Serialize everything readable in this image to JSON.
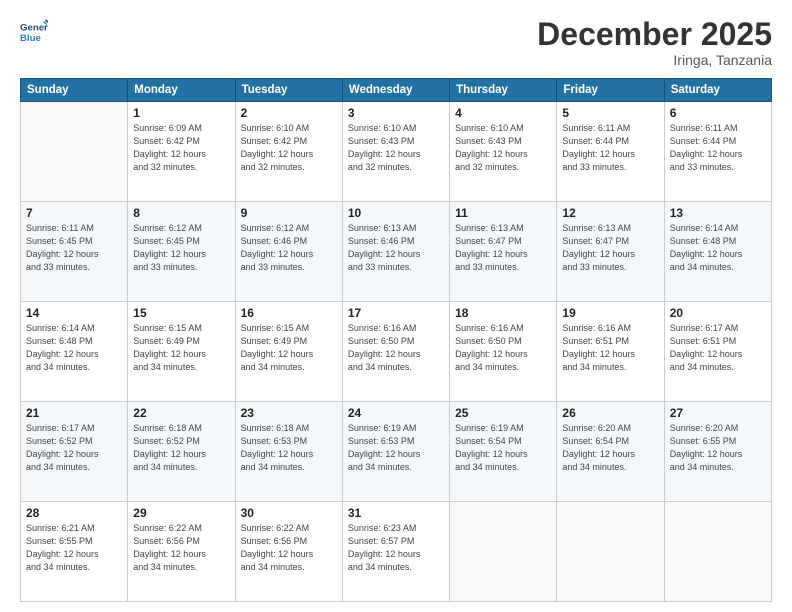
{
  "header": {
    "logo_line1": "General",
    "logo_line2": "Blue",
    "month": "December 2025",
    "location": "Iringa, Tanzania"
  },
  "days_of_week": [
    "Sunday",
    "Monday",
    "Tuesday",
    "Wednesday",
    "Thursday",
    "Friday",
    "Saturday"
  ],
  "weeks": [
    [
      {
        "day": "",
        "info": ""
      },
      {
        "day": "1",
        "info": "Sunrise: 6:09 AM\nSunset: 6:42 PM\nDaylight: 12 hours\nand 32 minutes."
      },
      {
        "day": "2",
        "info": "Sunrise: 6:10 AM\nSunset: 6:42 PM\nDaylight: 12 hours\nand 32 minutes."
      },
      {
        "day": "3",
        "info": "Sunrise: 6:10 AM\nSunset: 6:43 PM\nDaylight: 12 hours\nand 32 minutes."
      },
      {
        "day": "4",
        "info": "Sunrise: 6:10 AM\nSunset: 6:43 PM\nDaylight: 12 hours\nand 32 minutes."
      },
      {
        "day": "5",
        "info": "Sunrise: 6:11 AM\nSunset: 6:44 PM\nDaylight: 12 hours\nand 33 minutes."
      },
      {
        "day": "6",
        "info": "Sunrise: 6:11 AM\nSunset: 6:44 PM\nDaylight: 12 hours\nand 33 minutes."
      }
    ],
    [
      {
        "day": "7",
        "info": "Sunrise: 6:11 AM\nSunset: 6:45 PM\nDaylight: 12 hours\nand 33 minutes."
      },
      {
        "day": "8",
        "info": "Sunrise: 6:12 AM\nSunset: 6:45 PM\nDaylight: 12 hours\nand 33 minutes."
      },
      {
        "day": "9",
        "info": "Sunrise: 6:12 AM\nSunset: 6:46 PM\nDaylight: 12 hours\nand 33 minutes."
      },
      {
        "day": "10",
        "info": "Sunrise: 6:13 AM\nSunset: 6:46 PM\nDaylight: 12 hours\nand 33 minutes."
      },
      {
        "day": "11",
        "info": "Sunrise: 6:13 AM\nSunset: 6:47 PM\nDaylight: 12 hours\nand 33 minutes."
      },
      {
        "day": "12",
        "info": "Sunrise: 6:13 AM\nSunset: 6:47 PM\nDaylight: 12 hours\nand 33 minutes."
      },
      {
        "day": "13",
        "info": "Sunrise: 6:14 AM\nSunset: 6:48 PM\nDaylight: 12 hours\nand 34 minutes."
      }
    ],
    [
      {
        "day": "14",
        "info": "Sunrise: 6:14 AM\nSunset: 6:48 PM\nDaylight: 12 hours\nand 34 minutes."
      },
      {
        "day": "15",
        "info": "Sunrise: 6:15 AM\nSunset: 6:49 PM\nDaylight: 12 hours\nand 34 minutes."
      },
      {
        "day": "16",
        "info": "Sunrise: 6:15 AM\nSunset: 6:49 PM\nDaylight: 12 hours\nand 34 minutes."
      },
      {
        "day": "17",
        "info": "Sunrise: 6:16 AM\nSunset: 6:50 PM\nDaylight: 12 hours\nand 34 minutes."
      },
      {
        "day": "18",
        "info": "Sunrise: 6:16 AM\nSunset: 6:50 PM\nDaylight: 12 hours\nand 34 minutes."
      },
      {
        "day": "19",
        "info": "Sunrise: 6:16 AM\nSunset: 6:51 PM\nDaylight: 12 hours\nand 34 minutes."
      },
      {
        "day": "20",
        "info": "Sunrise: 6:17 AM\nSunset: 6:51 PM\nDaylight: 12 hours\nand 34 minutes."
      }
    ],
    [
      {
        "day": "21",
        "info": "Sunrise: 6:17 AM\nSunset: 6:52 PM\nDaylight: 12 hours\nand 34 minutes."
      },
      {
        "day": "22",
        "info": "Sunrise: 6:18 AM\nSunset: 6:52 PM\nDaylight: 12 hours\nand 34 minutes."
      },
      {
        "day": "23",
        "info": "Sunrise: 6:18 AM\nSunset: 6:53 PM\nDaylight: 12 hours\nand 34 minutes."
      },
      {
        "day": "24",
        "info": "Sunrise: 6:19 AM\nSunset: 6:53 PM\nDaylight: 12 hours\nand 34 minutes."
      },
      {
        "day": "25",
        "info": "Sunrise: 6:19 AM\nSunset: 6:54 PM\nDaylight: 12 hours\nand 34 minutes."
      },
      {
        "day": "26",
        "info": "Sunrise: 6:20 AM\nSunset: 6:54 PM\nDaylight: 12 hours\nand 34 minutes."
      },
      {
        "day": "27",
        "info": "Sunrise: 6:20 AM\nSunset: 6:55 PM\nDaylight: 12 hours\nand 34 minutes."
      }
    ],
    [
      {
        "day": "28",
        "info": "Sunrise: 6:21 AM\nSunset: 6:55 PM\nDaylight: 12 hours\nand 34 minutes."
      },
      {
        "day": "29",
        "info": "Sunrise: 6:22 AM\nSunset: 6:56 PM\nDaylight: 12 hours\nand 34 minutes."
      },
      {
        "day": "30",
        "info": "Sunrise: 6:22 AM\nSunset: 6:56 PM\nDaylight: 12 hours\nand 34 minutes."
      },
      {
        "day": "31",
        "info": "Sunrise: 6:23 AM\nSunset: 6:57 PM\nDaylight: 12 hours\nand 34 minutes."
      },
      {
        "day": "",
        "info": ""
      },
      {
        "day": "",
        "info": ""
      },
      {
        "day": "",
        "info": ""
      }
    ]
  ]
}
